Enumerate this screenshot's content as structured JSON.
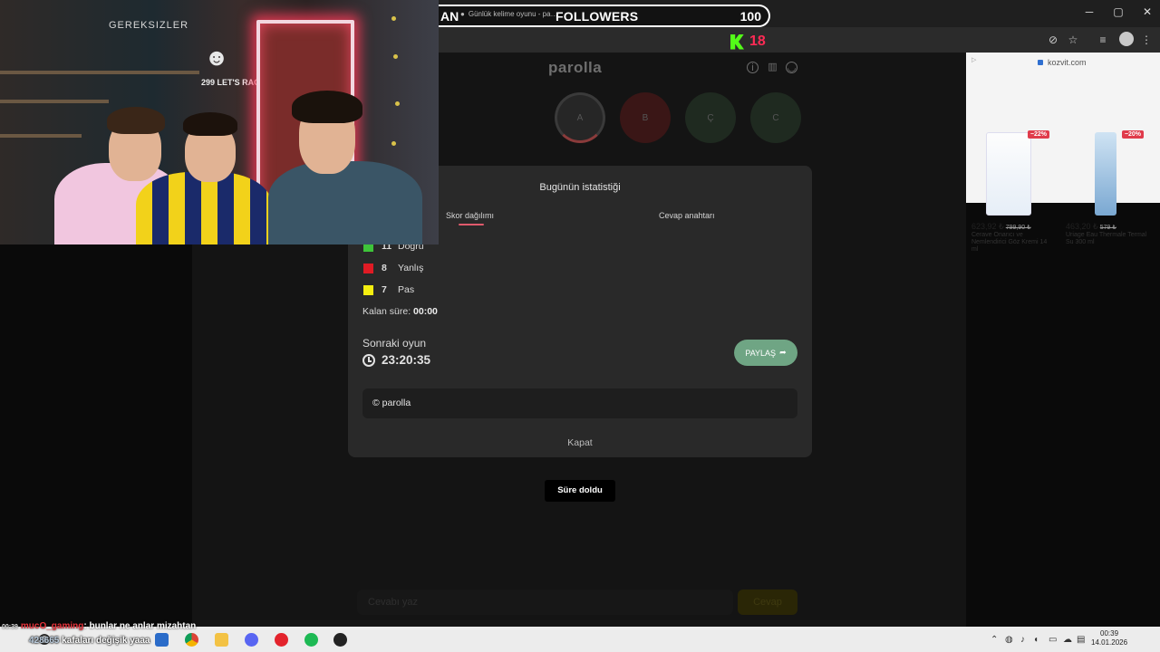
{
  "browser": {
    "tab_title": "Günlük kelime oyunu - pa…",
    "window_controls": {
      "minimize": "─",
      "maximize": "▢",
      "close": "✕"
    }
  },
  "overlay": {
    "followers_left": "AN",
    "followers_label": "FOLLOWERS",
    "followers_count": "100",
    "kick_count": "18"
  },
  "game": {
    "title": "parolla",
    "letters": [
      "A",
      "B",
      "Ç",
      "C"
    ],
    "answer_placeholder": "Cevabı yaz",
    "answer_button": "Cevap"
  },
  "modal": {
    "title": "Bugünün istatistiği",
    "tabs": [
      "Skor dağılımı",
      "Cevap anahtarı"
    ],
    "stats": [
      {
        "count": "11",
        "label": "Doğru",
        "color": "#3ec43a"
      },
      {
        "count": "8",
        "label": "Yanlış",
        "color": "#e01b24"
      },
      {
        "count": "7",
        "label": "Pas",
        "color": "#f4ee10"
      }
    ],
    "remaining_label": "Kalan süre:",
    "remaining_value": "00:00",
    "next_label": "Sonraki oyun",
    "next_time": "23:20:35",
    "share_label": "PAYLAŞ",
    "copyright": "© parolla",
    "close_label": "Kapat"
  },
  "toast": "Süre doldu",
  "ad": {
    "domain": "kozvit.com",
    "products": [
      {
        "discount": "−22%",
        "price": "623,92 ₺",
        "old_price": "799,90 ₺",
        "name": "Cerave Onarıcı ve Nemlendirici Göz Kremi 14 ml"
      },
      {
        "discount": "−20%",
        "price": "463,20 ₺",
        "old_price": "579 ₺",
        "name": "Uriage Eau Thermale Termal Su 300 ml"
      }
    ]
  },
  "webcam": {
    "wall_text": "GEREKSIZLER",
    "poster_text": "299 LET'S RACE HARD"
  },
  "chat": {
    "time": "00:39",
    "user": "mucO_gaming",
    "message": ": bunlar ne anlar mizahtan",
    "line2_count": "428665",
    "line2_text": "kafaları değişik yaaa"
  },
  "system": {
    "clock": "00:39",
    "date": "14.01.2026"
  },
  "colors": {
    "correct": "#3ec43a",
    "wrong": "#e01b24",
    "pass": "#f4ee10",
    "share": "#6fa584",
    "kick": "#53fc18"
  }
}
